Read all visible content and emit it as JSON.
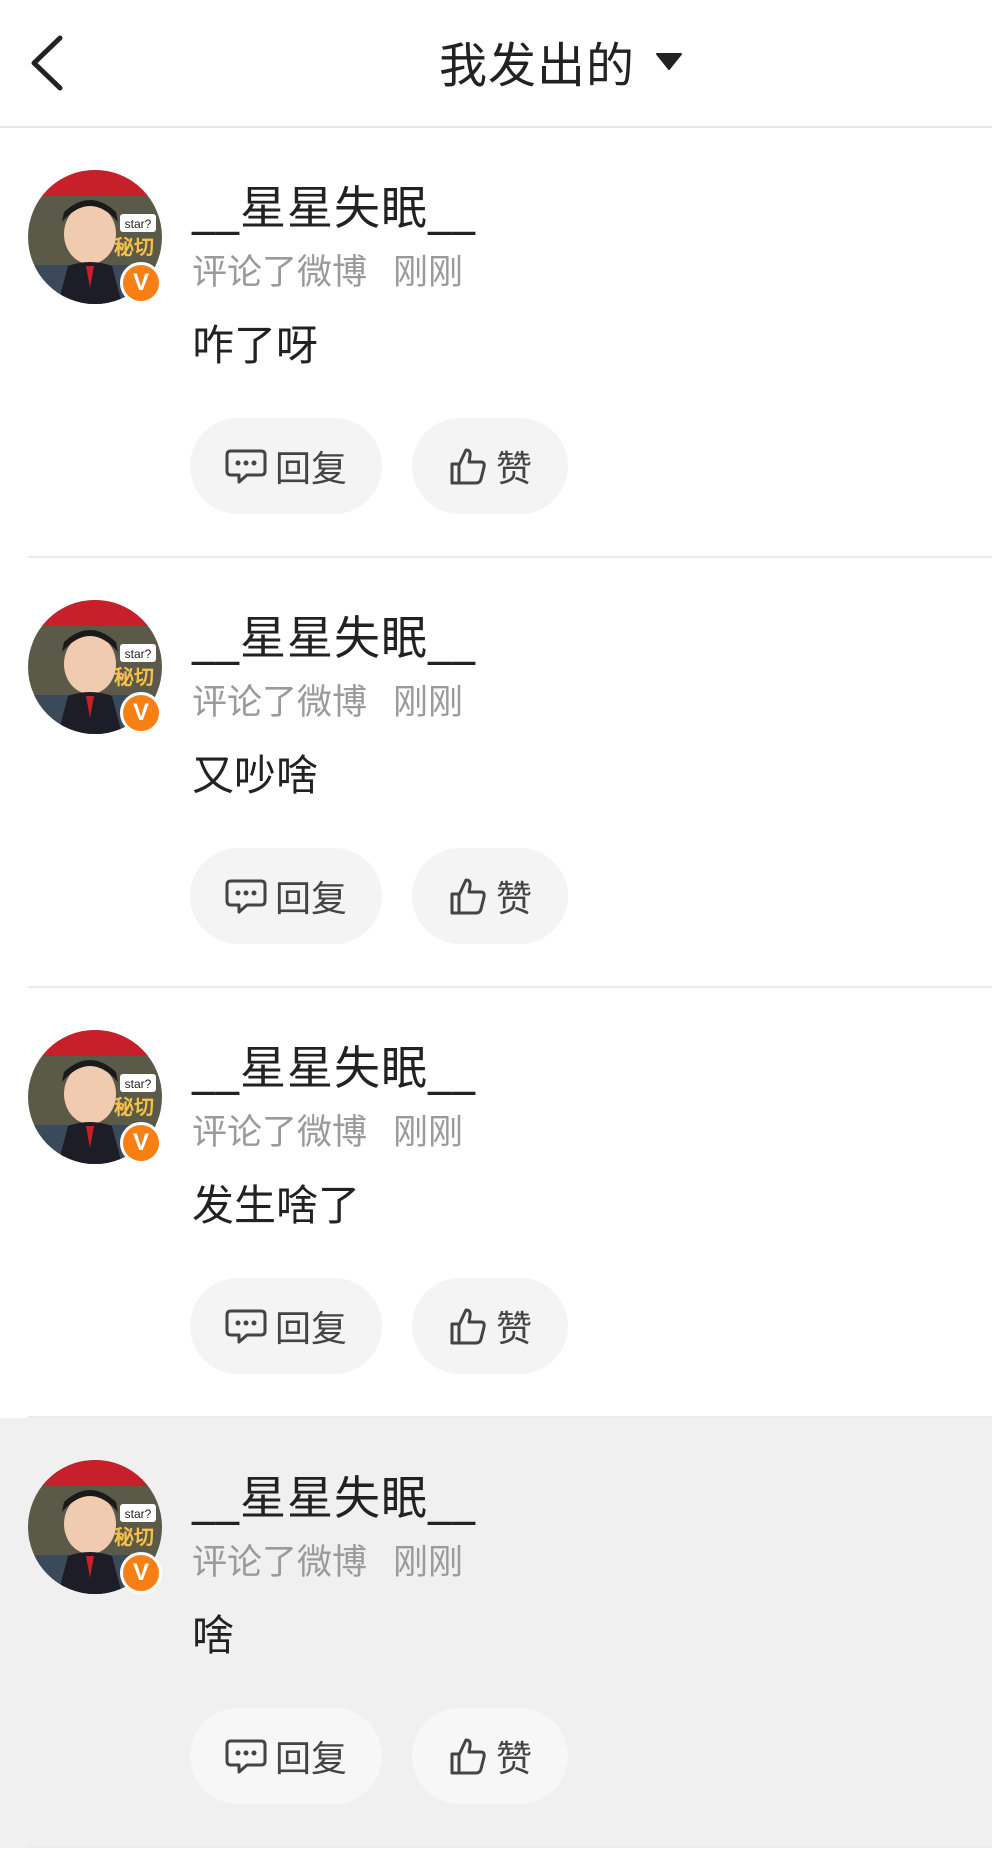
{
  "header": {
    "title": "我发出的",
    "back_icon": "chevron-left-icon",
    "dropdown_icon": "triangle-down-icon"
  },
  "comments": [
    {
      "username": "__星星失眠__",
      "action": "评论了微博",
      "time": "刚刚",
      "content": "咋了呀",
      "reply_label": "回复",
      "like_label": "赞",
      "verified": "V"
    },
    {
      "username": "__星星失眠__",
      "action": "评论了微博",
      "time": "刚刚",
      "content": "又吵啥",
      "reply_label": "回复",
      "like_label": "赞",
      "verified": "V"
    },
    {
      "username": "__星星失眠__",
      "action": "评论了微博",
      "time": "刚刚",
      "content": "发生啥了",
      "reply_label": "回复",
      "like_label": "赞",
      "verified": "V"
    },
    {
      "username": "__星星失眠__",
      "action": "评论了微博",
      "time": "刚刚",
      "content": "啥",
      "reply_label": "回复",
      "like_label": "赞",
      "verified": "V"
    }
  ],
  "colors": {
    "verified_badge": "#f77f14",
    "highlight_row": "#f0f0f0",
    "meta_text": "#9a9a9a"
  }
}
